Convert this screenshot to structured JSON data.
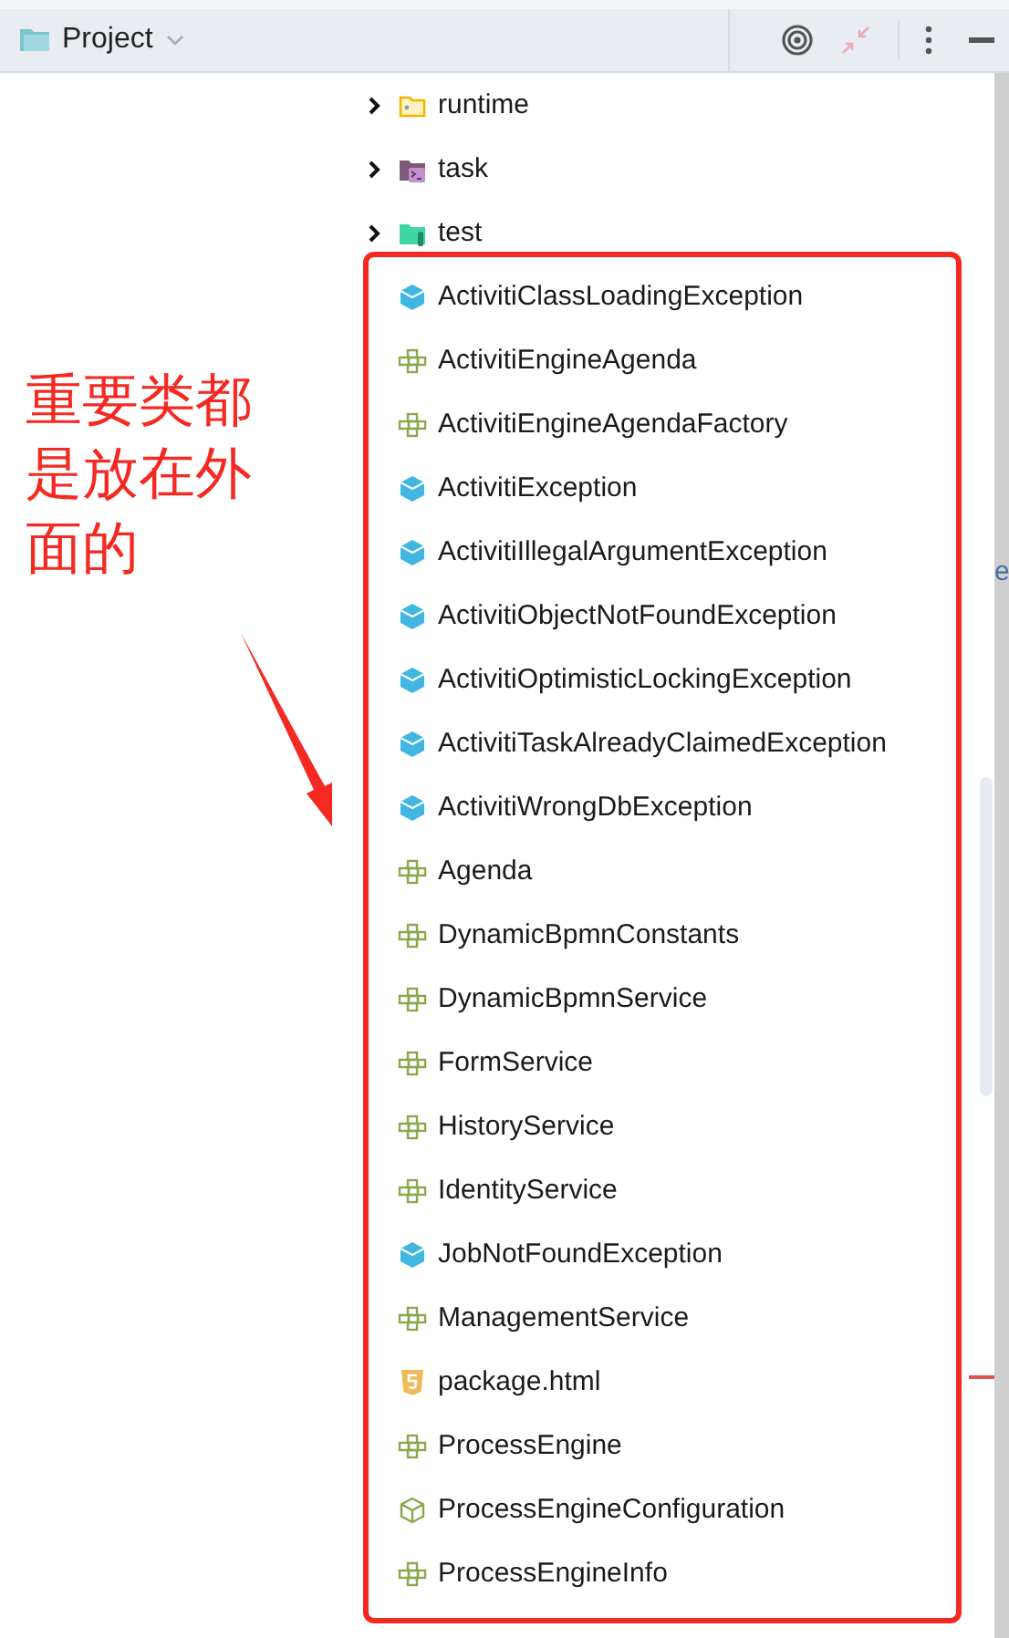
{
  "header": {
    "title": "Project"
  },
  "folders": [
    {
      "label": "runtime",
      "kind": "package",
      "expanded": false
    },
    {
      "label": "task",
      "kind": "script",
      "expanded": false
    },
    {
      "label": "test",
      "kind": "test",
      "expanded": false
    }
  ],
  "items": [
    {
      "label": "ActivitiClassLoadingException",
      "kind": "exception"
    },
    {
      "label": "ActivitiEngineAgenda",
      "kind": "interface"
    },
    {
      "label": "ActivitiEngineAgendaFactory",
      "kind": "interface"
    },
    {
      "label": "ActivitiException",
      "kind": "exception"
    },
    {
      "label": "ActivitiIllegalArgumentException",
      "kind": "exception"
    },
    {
      "label": "ActivitiObjectNotFoundException",
      "kind": "exception"
    },
    {
      "label": "ActivitiOptimisticLockingException",
      "kind": "exception"
    },
    {
      "label": "ActivitiTaskAlreadyClaimedException",
      "kind": "exception"
    },
    {
      "label": "ActivitiWrongDbException",
      "kind": "exception"
    },
    {
      "label": "Agenda",
      "kind": "interface"
    },
    {
      "label": "DynamicBpmnConstants",
      "kind": "interface"
    },
    {
      "label": "DynamicBpmnService",
      "kind": "interface"
    },
    {
      "label": "FormService",
      "kind": "interface"
    },
    {
      "label": "HistoryService",
      "kind": "interface"
    },
    {
      "label": "IdentityService",
      "kind": "interface"
    },
    {
      "label": "JobNotFoundException",
      "kind": "exception"
    },
    {
      "label": "ManagementService",
      "kind": "interface"
    },
    {
      "label": "package.html",
      "kind": "html"
    },
    {
      "label": "ProcessEngine",
      "kind": "interface"
    },
    {
      "label": "ProcessEngineConfiguration",
      "kind": "abstract"
    },
    {
      "label": "ProcessEngineInfo",
      "kind": "interface"
    }
  ],
  "annotation": {
    "text": "重要类都是放在外面的"
  },
  "side_strip": {
    "text": "e"
  }
}
